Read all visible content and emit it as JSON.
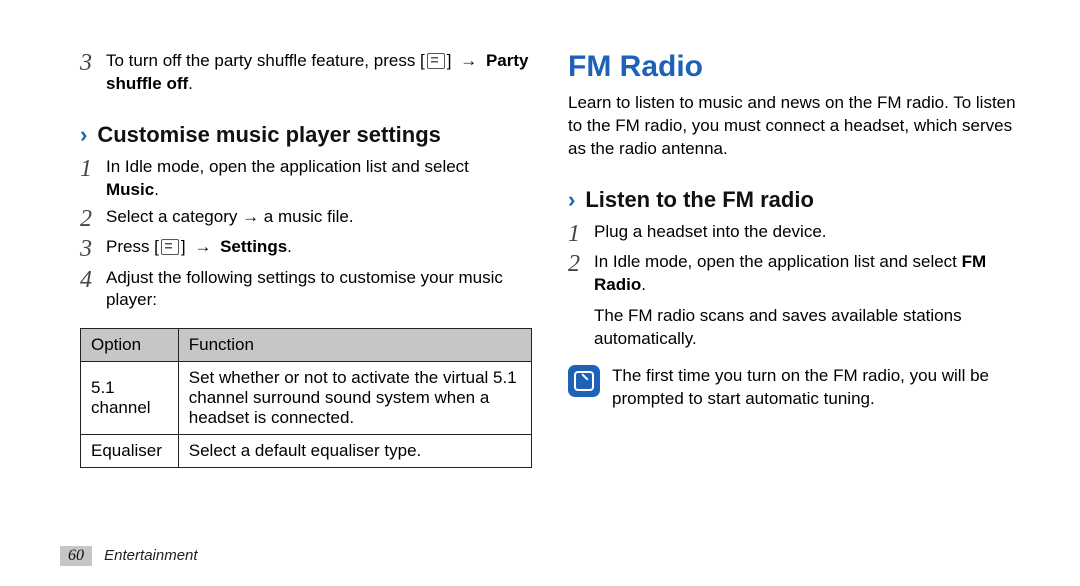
{
  "left": {
    "step3_top": {
      "pre": "To turn off the party shuffle feature, press [",
      "post": "] ",
      "arrow": "→",
      "bold1": "Party",
      "bold2": "shuffle off",
      "period": "."
    },
    "subhead": "Customise music player settings",
    "step1": {
      "line": "In Idle mode, open the application list and select",
      "bold": "Music",
      "period": "."
    },
    "step2": "Select a category → a music file.",
    "step3": {
      "pre": "Press [",
      "post": "] ",
      "arrow": "→",
      "bold": "Settings",
      "period": "."
    },
    "step4": "Adjust the following settings to customise your music player:",
    "table": {
      "h1": "Option",
      "h2": "Function",
      "r1c1": "5.1 channel",
      "r1c2": "Set whether or not to activate the virtual 5.1 channel surround sound system when a headset is connected.",
      "r2c1": "Equaliser",
      "r2c2": "Select a default equaliser type."
    }
  },
  "right": {
    "title": "FM Radio",
    "intro": "Learn to listen to music and news on the FM radio. To listen to the FM radio, you must connect a headset, which serves as the radio antenna.",
    "subhead": "Listen to the FM radio",
    "step1": "Plug a headset into the device.",
    "step2": {
      "line": "In Idle mode, open the application list and select ",
      "bold": "FM Radio",
      "period": "."
    },
    "step2_cont": "The FM radio scans and saves available stations automatically.",
    "note": "The first time you turn on the FM radio, you will be prompted to start automatic tuning."
  },
  "footer": {
    "page": "60",
    "section": "Entertainment"
  },
  "nums": {
    "n1": "1",
    "n2": "2",
    "n3": "3",
    "n4": "4"
  }
}
